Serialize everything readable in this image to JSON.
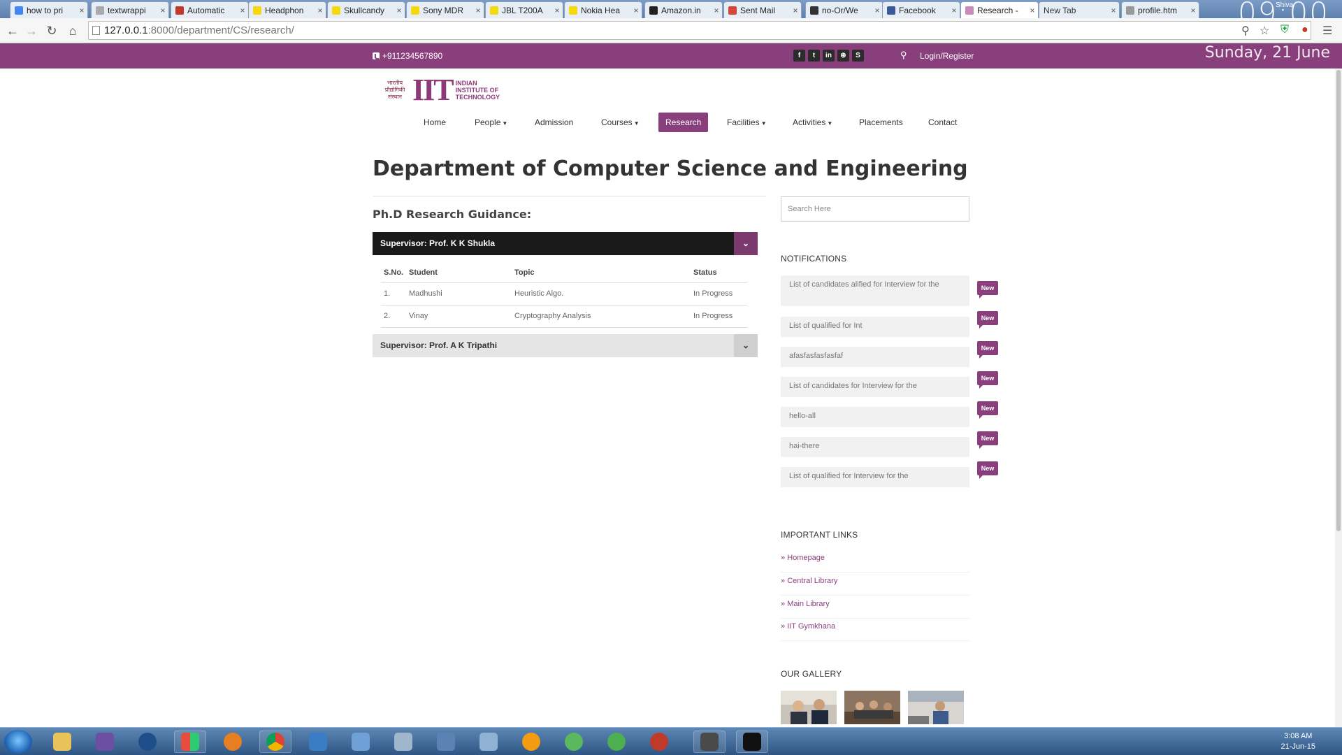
{
  "browser": {
    "tabs": [
      {
        "label": "how to pri",
        "icon": "google-icon",
        "color": "#4285f4"
      },
      {
        "label": "textwrappi",
        "icon": "page-icon",
        "color": "#aaaaaa"
      },
      {
        "label": "Automatic",
        "icon": "as-icon",
        "color": "#c0392b"
      },
      {
        "label": "Headphon",
        "icon": "flipkart-icon",
        "color": "#f5d90a"
      },
      {
        "label": "Skullcandy",
        "icon": "flipkart-icon",
        "color": "#f5d90a"
      },
      {
        "label": "Sony MDR",
        "icon": "flipkart-icon",
        "color": "#f5d90a"
      },
      {
        "label": "JBL T200A",
        "icon": "flipkart-icon",
        "color": "#f5d90a"
      },
      {
        "label": "Nokia Hea",
        "icon": "flipkart-icon",
        "color": "#f5d90a"
      },
      {
        "label": "Amazon.in",
        "icon": "amazon-icon",
        "color": "#222222"
      },
      {
        "label": "Sent Mail",
        "icon": "gmail-icon",
        "color": "#d44638"
      },
      {
        "label": "no-Or/We",
        "icon": "github-icon",
        "color": "#333333"
      },
      {
        "label": "Facebook",
        "icon": "facebook-icon",
        "color": "#3b5998"
      },
      {
        "label": "Research -",
        "icon": "site-icon",
        "color": "#c98bb9",
        "active": true
      },
      {
        "label": "New Tab",
        "icon": "",
        "color": ""
      },
      {
        "label": "profile.htm",
        "icon": "file-icon",
        "color": "#999999"
      }
    ],
    "url_host": "127.0.0.1",
    "url_rest": ":8000/department/CS/research/",
    "overlay_clock": "09:00",
    "window_user": "Shiva"
  },
  "site": {
    "phone": "+911234567890",
    "social": [
      "f",
      "t",
      "in",
      "⊛",
      "S"
    ],
    "login": "Login/Register",
    "date_overlay": "Sunday, 21 June",
    "logo": {
      "deva_text": "भारतीय प्रौद्योगिकी संस्थान",
      "big": "IIT",
      "line1": "INDIAN",
      "line2": "INSTITUTE OF",
      "line3": "TECHNOLOGY"
    },
    "nav": [
      {
        "label": "Home",
        "caret": false
      },
      {
        "label": "People",
        "caret": true
      },
      {
        "label": "Admission",
        "caret": false
      },
      {
        "label": "Courses",
        "caret": true
      },
      {
        "label": "Research",
        "caret": false,
        "active": true
      },
      {
        "label": "Facilities",
        "caret": true
      },
      {
        "label": "Activities",
        "caret": true
      },
      {
        "label": "Placements",
        "caret": false
      },
      {
        "label": "Contact",
        "caret": false
      }
    ]
  },
  "main": {
    "title": "Department of Computer Science and Engineering",
    "section_heading": "Ph.D Research Guidance:",
    "supervisors": [
      {
        "label": "Supervisor: Prof. K K Shukla",
        "open": true
      },
      {
        "label": "Supervisor: Prof. A K Tripathi",
        "open": false
      }
    ],
    "table": {
      "headers": [
        "S.No.",
        "Student",
        "Topic",
        "Status"
      ],
      "rows": [
        [
          "1.",
          "Madhushi",
          "Heuristic Algo.",
          "In Progress"
        ],
        [
          "2.",
          "Vinay",
          "Cryptography Analysis",
          "In Progress"
        ]
      ]
    }
  },
  "sidebar": {
    "search_placeholder": "Search Here",
    "notifications_title": "NOTIFICATIONS",
    "notifications": [
      "List of candidates alified for Interview for the",
      "List of qualified for Int",
      "afasfasfasfasfaf",
      "List of candidates for Interview for the",
      "hello-all",
      "hai-there",
      "List of qualified for Interview for the"
    ],
    "badge_label": "New",
    "links_title": "IMPORTANT LINKS",
    "links": [
      "Homepage",
      "Central Library",
      "Main Library",
      "IIT Gymkhana"
    ],
    "gallery_title": "OUR GALLERY"
  },
  "taskbar": {
    "time": "3:08 AM",
    "date": "21-Jun-15"
  }
}
